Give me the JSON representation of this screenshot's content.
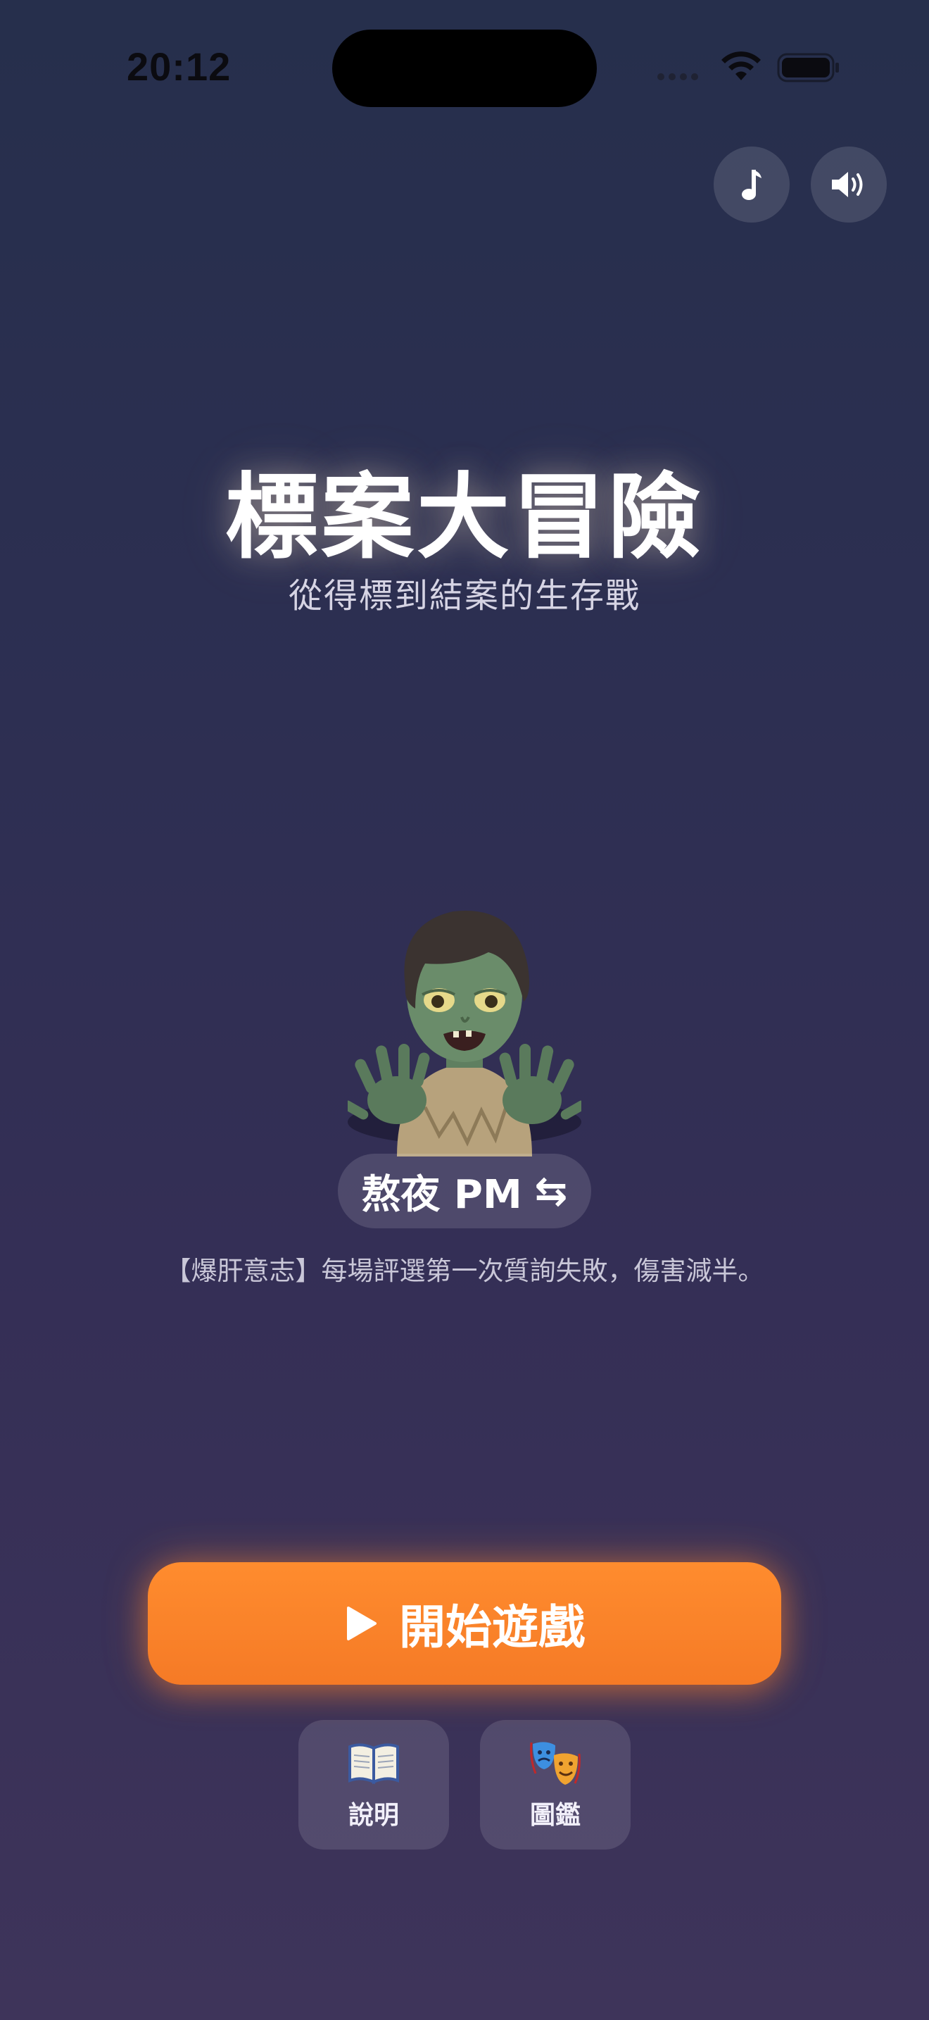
{
  "status_bar": {
    "time": "20:12"
  },
  "controls": {
    "music_icon": "music-note-icon",
    "sound_icon": "speaker-icon"
  },
  "game": {
    "title": "標案大冒險",
    "subtitle": "從得標到結案的生存戰"
  },
  "character": {
    "name": "熬夜 PM",
    "swap_icon": "⇆",
    "avatar_icon": "zombie-icon",
    "ability": "【爆肝意志】每場評選第一次質詢失敗，傷害減半。"
  },
  "actions": {
    "start_label": "開始遊戲",
    "start_icon": "play-icon",
    "help_label": "說明",
    "help_icon": "open-book-icon",
    "dex_label": "圖鑑",
    "dex_icon": "theater-masks-icon"
  },
  "colors": {
    "accent": "#f98a2c",
    "background_top": "#262f4c",
    "background_bottom": "#3e345a"
  }
}
